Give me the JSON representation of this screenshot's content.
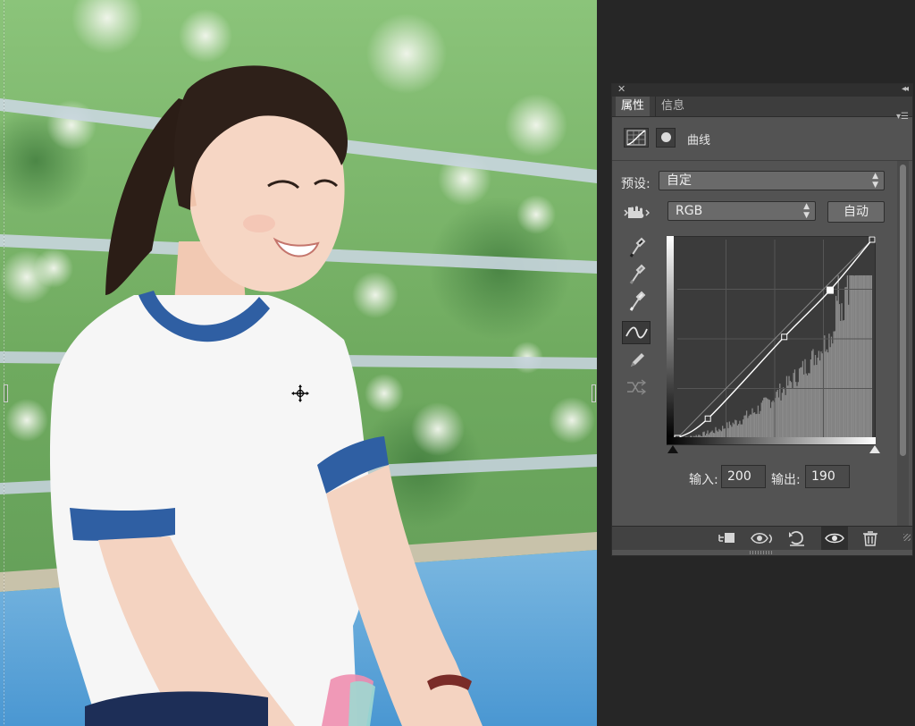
{
  "panel": {
    "tabs": [
      {
        "label": "属性",
        "active": true
      },
      {
        "label": "信息",
        "active": false
      }
    ],
    "adjustment_title": "曲线",
    "preset_label": "预设:",
    "preset_value": "自定",
    "channel_value": "RGB",
    "auto_label": "自动",
    "input_label": "输入:",
    "input_value": "200",
    "output_label": "输出:",
    "output_value": "190",
    "curve_points": [
      {
        "input": 0,
        "output": 0
      },
      {
        "input": 40,
        "output": 25
      },
      {
        "input": 140,
        "output": 130
      },
      {
        "input": 200,
        "output": 190
      },
      {
        "input": 255,
        "output": 255
      }
    ],
    "selected_point_input": 200,
    "tools": [
      "shadow-eyedropper",
      "midtone-eyedropper",
      "highlight-eyedropper",
      "curve-point-tool",
      "pencil-tool",
      "smooth-tool"
    ],
    "active_tool": "curve-point-tool",
    "bottom_buttons": [
      "clip-to-layer",
      "view-previous-state",
      "reset-adjustment",
      "toggle-visibility",
      "delete-adjustment"
    ]
  },
  "colors": {
    "panel_bg": "#535353",
    "workspace_bg": "#262626",
    "shirt_trim": "#2f5fa3"
  }
}
